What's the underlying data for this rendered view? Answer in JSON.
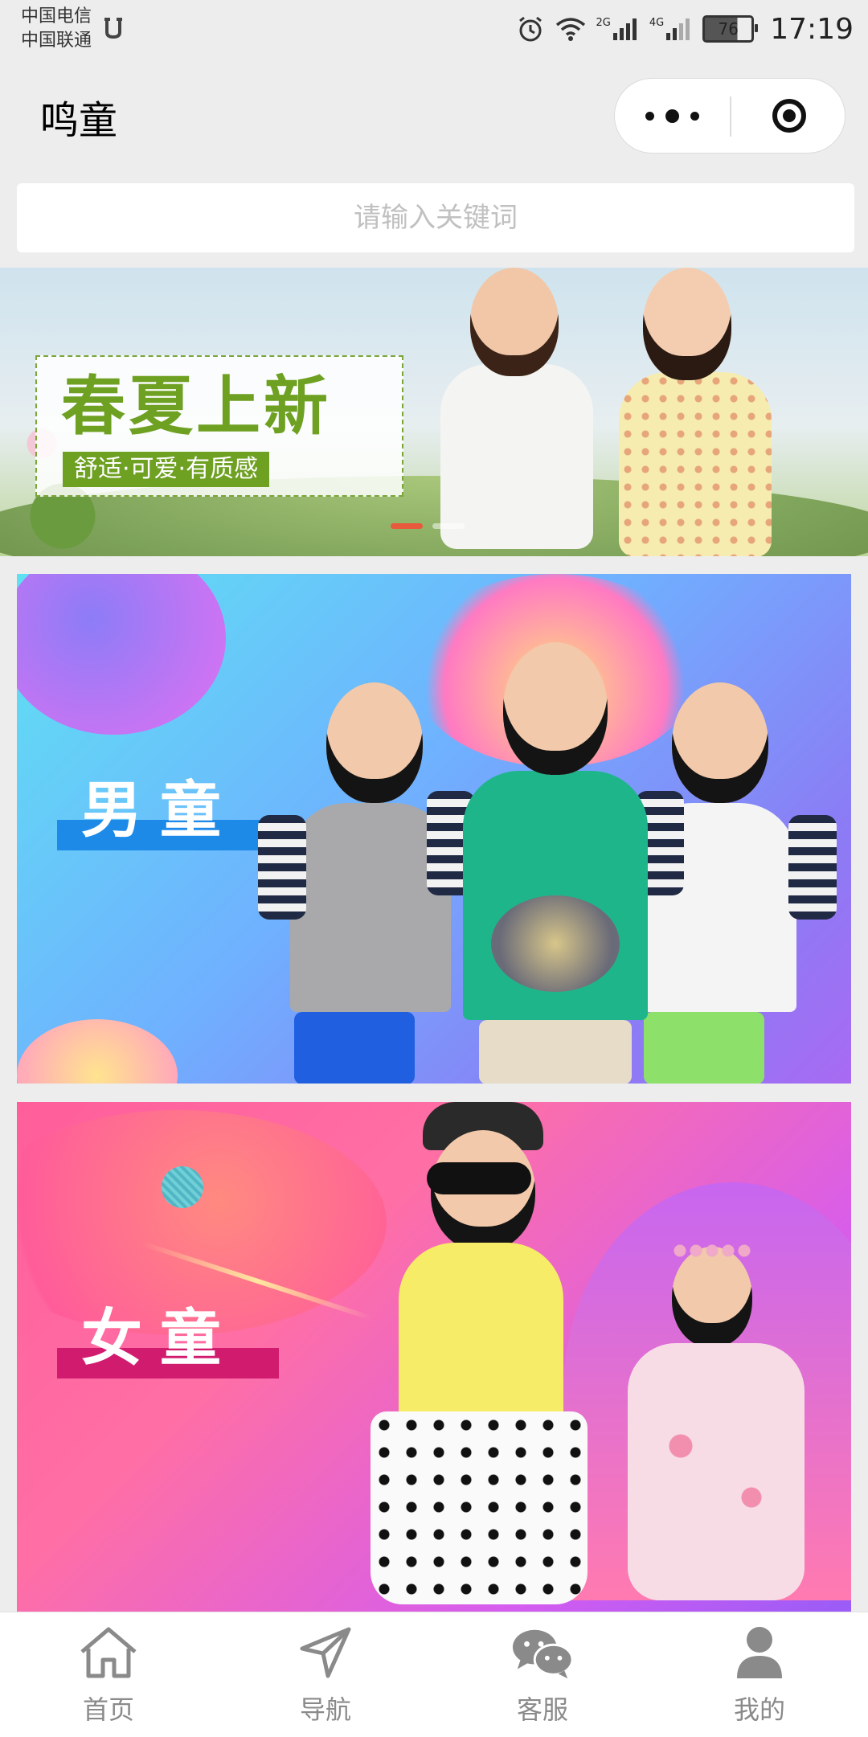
{
  "status_bar": {
    "carrier_1": "中国电信",
    "carrier_2": "中国联通",
    "signal_1_label": "2G",
    "signal_2_label": "4G",
    "battery": "76",
    "time": "17:19"
  },
  "header": {
    "title": "鸣童"
  },
  "search": {
    "placeholder": "请输入关键词",
    "value": ""
  },
  "carousel": {
    "slide_title": "春夏上新",
    "slide_subtitle": "舒适·可爱·有质感",
    "slide_count": 2,
    "active_index": 0
  },
  "categories": [
    {
      "label": "男童",
      "color": "#1e8ae8"
    },
    {
      "label": "女童",
      "color": "#d11b6e"
    }
  ],
  "tabbar": {
    "items": [
      {
        "label": "首页",
        "icon": "home-icon"
      },
      {
        "label": "导航",
        "icon": "navigation-arrow-icon"
      },
      {
        "label": "客服",
        "icon": "wechat-chat-icon"
      },
      {
        "label": "我的",
        "icon": "user-profile-icon"
      }
    ]
  }
}
